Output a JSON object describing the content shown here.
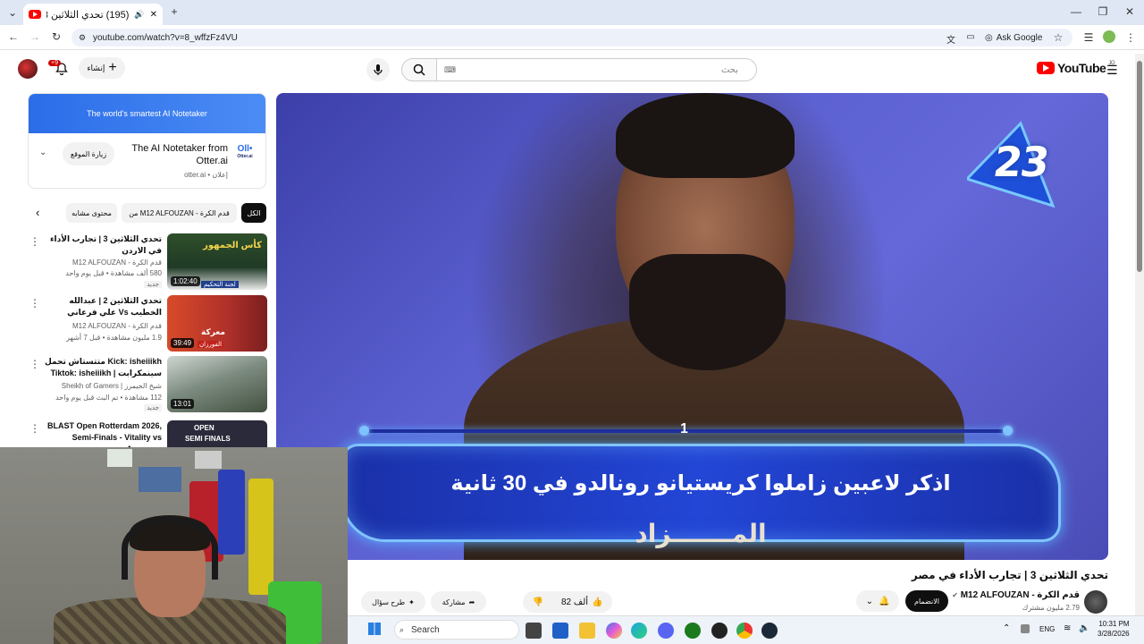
{
  "browser": {
    "tab_title": "(195) تحدي الثلاثين 3 | تجارب",
    "url": "youtube.com/watch?v=8_wffzFz4VU",
    "ask_google": "Ask Google",
    "new_tab": "+"
  },
  "masthead": {
    "search_placeholder": "بحث",
    "create_label": "إنشاء",
    "notification_count": "+9",
    "logo_text": "YouTube",
    "logo_country": "JO"
  },
  "ad": {
    "banner_text": "The world's smartest AI Notetaker",
    "title": "The AI Notetaker from Otter.ai",
    "meta": "إعلان • otter.ai",
    "visit_label": "زيارة الموقع",
    "logo_text": "Otter.ai",
    "logo_mark": "Oll•"
  },
  "chips": [
    {
      "label": "الكل",
      "active": true
    },
    {
      "label": "من M12 ALFOUZAN - قدم الكرة",
      "active": false
    },
    {
      "label": "محتوى مشابه",
      "active": false
    }
  ],
  "recommendations": [
    {
      "title": "تحدي الثلاثين 3 | تجارب الأداء في الاردن",
      "channel": "قدم الكرة - M12 ALFOUZAN",
      "stats": "580 ألف مشاهدة • قبل يوم واحد",
      "badge": "جديد",
      "duration": "1:02:40"
    },
    {
      "title": "تحدي الثلاثين 2 | عبدالله الخطيب Vs علي فرعاني",
      "channel": "قدم الكرة - M12 ALFOUZAN",
      "stats": "1.9 مليون مشاهدة • قبل 7 أشهر",
      "badge": "",
      "duration": "39:49"
    },
    {
      "title": "Kick: isheiiikh متتستاش تحمل سينمكرابت | Tiktok: isheiiikh",
      "channel": "شيخ الجيمرز | Sheikh of Gamers",
      "stats": "112 مشاهدة • تم البث قبل يوم واحد",
      "badge": "جديد",
      "duration": "13:01"
    },
    {
      "title": "BLAST Open Rotterdam 2026, Semi-Finals - Vitality vs Aurora,...",
      "channel": "",
      "stats": "",
      "badge": "",
      "duration": ""
    }
  ],
  "thumb_texts": {
    "t1_line1": "كأس الجمهور",
    "t1_line2": "لجنة التحكيم",
    "t2_line1": "معركة",
    "t2_line2": "الفورزان",
    "t4_line1": "OPEN",
    "t4_line2": "SEMI FINALS"
  },
  "player": {
    "timer": "23",
    "round": "1",
    "question": "اذكر لاعبين زاملوا كريستيانو رونالدو في 30 ثانية",
    "subtitle": "المـــــــزاد"
  },
  "video": {
    "title": "تحدي الثلاثين 3 | تجارب الأداء في مصر",
    "channel_name": "قدم الكرة - M12 ALFOUZAN",
    "subscribers": "2.79 مليون مشترك",
    "join_label": "الانضمام",
    "like_count": "82 ألف",
    "share_label": "مشاركة",
    "ask_label": "طرح سؤال"
  },
  "taskbar": {
    "search_label": "Search",
    "lang": "ENG",
    "time": "10:31 PM",
    "date": "3/28/2026"
  }
}
